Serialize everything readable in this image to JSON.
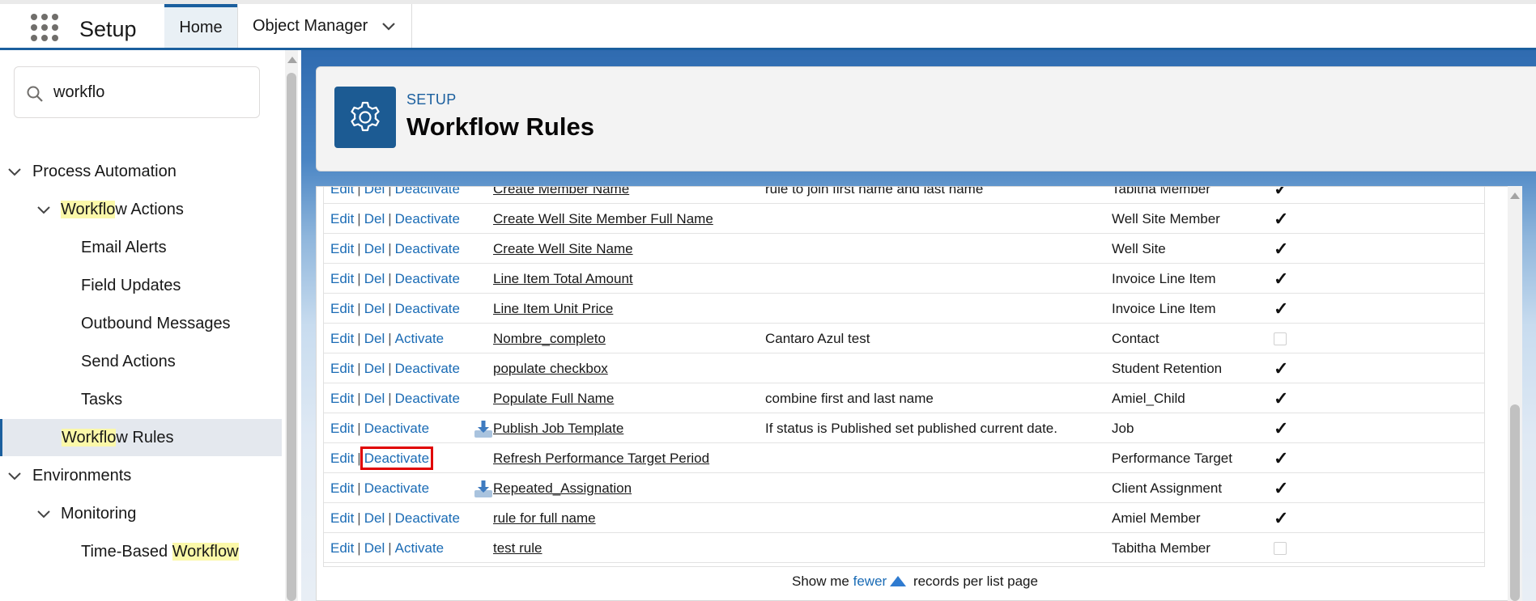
{
  "nav": {
    "app_title": "Setup",
    "tabs": [
      {
        "label": "Home"
      },
      {
        "label": "Object Manager"
      }
    ]
  },
  "sidebar": {
    "search_value": "workflo",
    "tree": {
      "process_automation": "Process Automation",
      "workflow_actions_hl": "Workflo",
      "workflow_actions_rest": "w Actions",
      "email_alerts": "Email Alerts",
      "field_updates": "Field Updates",
      "outbound_messages": "Outbound Messages",
      "send_actions": "Send Actions",
      "tasks": "Tasks",
      "workflow_rules_hl": "Workflo",
      "workflow_rules_rest": "w Rules",
      "environments": "Environments",
      "monitoring": "Monitoring",
      "time_based_prefix": "Time-Based ",
      "time_based_hl": "Workflow"
    }
  },
  "header": {
    "eyebrow": "SETUP",
    "title": "Workflow Rules"
  },
  "labels": {
    "edit": "Edit",
    "del": "Del",
    "activate": "Activate",
    "deactivate": "Deactivate",
    "sep": "|"
  },
  "rules": [
    {
      "name": "Create Member Name",
      "description": "rule to join first name and last name",
      "object": "Tabitha Member",
      "active": true,
      "has_del": true,
      "packaged": false
    },
    {
      "name": "Create Well Site Member Full Name",
      "description": "",
      "object": "Well Site Member",
      "active": true,
      "has_del": true,
      "packaged": false
    },
    {
      "name": "Create Well Site Name",
      "description": "",
      "object": "Well Site",
      "active": true,
      "has_del": true,
      "packaged": false
    },
    {
      "name": "Line Item Total Amount",
      "description": "",
      "object": "Invoice Line Item",
      "active": true,
      "has_del": true,
      "packaged": false
    },
    {
      "name": "Line Item Unit Price",
      "description": "",
      "object": "Invoice Line Item",
      "active": true,
      "has_del": true,
      "packaged": false
    },
    {
      "name": "Nombre_completo",
      "description": "Cantaro Azul test",
      "object": "Contact",
      "active": false,
      "has_del": true,
      "packaged": false
    },
    {
      "name": "populate checkbox",
      "description": "",
      "object": "Student Retention",
      "active": true,
      "has_del": true,
      "packaged": false
    },
    {
      "name": "Populate Full Name",
      "description": "combine first and last name",
      "object": "Amiel_Child",
      "active": true,
      "has_del": true,
      "packaged": false
    },
    {
      "name": "Publish Job Template",
      "description": "If status is Published set published current date.",
      "object": "Job",
      "active": true,
      "has_del": false,
      "packaged": true
    },
    {
      "name": "Refresh Performance Target Period",
      "description": "",
      "object": "Performance Target",
      "active": true,
      "has_del": false,
      "packaged": false,
      "highlighted": true
    },
    {
      "name": "Repeated_Assignation",
      "description": "",
      "object": "Client Assignment",
      "active": true,
      "has_del": false,
      "packaged": true
    },
    {
      "name": "rule for full name",
      "description": "",
      "object": "Amiel Member",
      "active": true,
      "has_del": true,
      "packaged": false
    },
    {
      "name": "test rule",
      "description": "",
      "object": "Tabitha Member",
      "active": false,
      "has_del": true,
      "packaged": false
    }
  ],
  "footer": {
    "prefix": "Show me",
    "link": "fewer",
    "suffix": "records per list page"
  }
}
